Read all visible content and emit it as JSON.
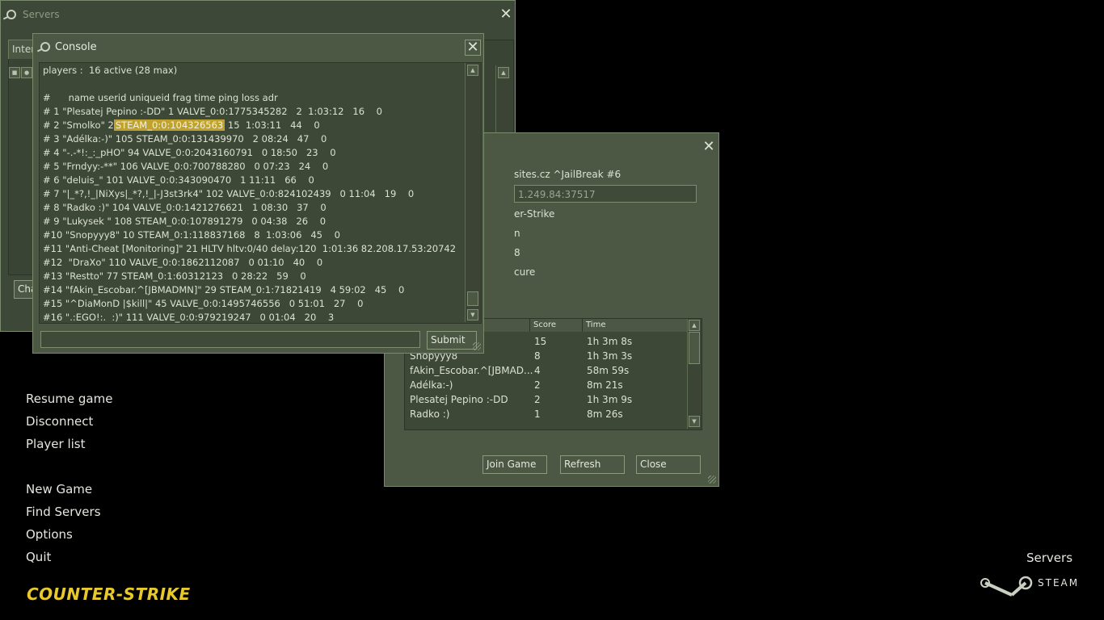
{
  "servers_window": {
    "title": "Servers",
    "tab_label": "Inter",
    "chat_btn": "Cha",
    "right_btn": "t"
  },
  "info_window": {
    "name_fragment": "sites.cz ^JailBreak #6",
    "address": "1.249.84:37517",
    "game_fragment": "er-Strike",
    "map_fragment": "n",
    "players_fragment": "8",
    "secure_fragment": "cure",
    "table": {
      "headers": [
        "Score",
        "Time"
      ],
      "rows": [
        {
          "name": "",
          "score": "15",
          "time": "1h 3m 8s"
        },
        {
          "name": "Snopyyy8",
          "score": "8",
          "time": "1h 3m 3s"
        },
        {
          "name": "fAkin_Escobar.^[JBMAD...",
          "score": "4",
          "time": "58m 59s"
        },
        {
          "name": "Adélka:-)",
          "score": "2",
          "time": "8m 21s"
        },
        {
          "name": "Plesatej Pepino :-DD",
          "score": "2",
          "time": "1h 3m 9s"
        },
        {
          "name": "Radko :)",
          "score": "1",
          "time": "8m 26s"
        }
      ]
    },
    "buttons": {
      "join": "Join Game",
      "refresh": "Refresh",
      "close": "Close"
    }
  },
  "console": {
    "title": "Console",
    "lines": [
      "players :  16 active (28 max)",
      "",
      "#      name userid uniqueid frag time ping loss adr",
      "# 1 \"Plesatej Pepino :-DD\" 1 VALVE_0:0:1775345282   2  1:03:12   16    0",
      "# 2 \"Smolko\" 2",
      "# 3 \"Adélka:-)\" 105 STEAM_0:0:131439970   2 08:24   47    0",
      "# 4 \"-.-*!:_:_pHO\" 94 VALVE_0:0:2043160791   0 18:50   23    0",
      "# 5 \"Frndyy:-**\" 106 VALVE_0:0:700788280   0 07:23   24    0",
      "# 6 \"deluis_\" 101 VALVE_0:0:343090470   1 11:11   66    0",
      "# 7 \"|_*?,!_|NiXys|_*?,!_|-J3st3rk4\" 102 VALVE_0:0:824102439   0 11:04   19    0",
      "# 8 \"Radko :)\" 104 VALVE_0:0:1421276621   1 08:30   37    0",
      "# 9 \"Lukysek \" 108 STEAM_0:0:107891279   0 04:38   26    0",
      "#10 \"Snopyyy8\" 10 STEAM_0:1:118837168   8  1:03:06   45    0",
      "#11 \"Anti-Cheat [Monitoring]\" 21 HLTV hltv:0/40 delay:120  1:01:36 82.208.17.53:20742",
      "#12  \"DraXo\" 110 VALVE_0:0:1862112087   0 01:10   40    0",
      "#13 \"Restto\" 77 STEAM_0:1:60312123   0 28:22   59    0",
      "#14 \"fAkin_Escobar.^[JBMADMN]\" 29 STEAM_0:1:71821419   4 59:02   45    0",
      "#15 \"^DiaMonD |$kill|\" 45 VALVE_0:0:1495746556   0 51:01   27    0",
      "#16 \".:EGO!:.  :)\" 111 VALVE_0:0:979219247   0 01:04   20    3"
    ],
    "highlight": "STEAM_0:0:104326563",
    "line2_tail": " 15  1:03:11   44    0",
    "input_value": "",
    "submit_label": "Submit"
  },
  "menu": {
    "items": [
      "Resume game",
      "Disconnect",
      "Player list",
      "New Game",
      "Find Servers",
      "Options",
      "Quit"
    ]
  },
  "branding": {
    "game_logo": "COUNTER-STRIKE",
    "servers_link": "Servers",
    "steam": "STEAM"
  },
  "colors": {
    "panel": "#4c5844",
    "highlight": "#bfa32e",
    "logo": "#e8c92c"
  }
}
